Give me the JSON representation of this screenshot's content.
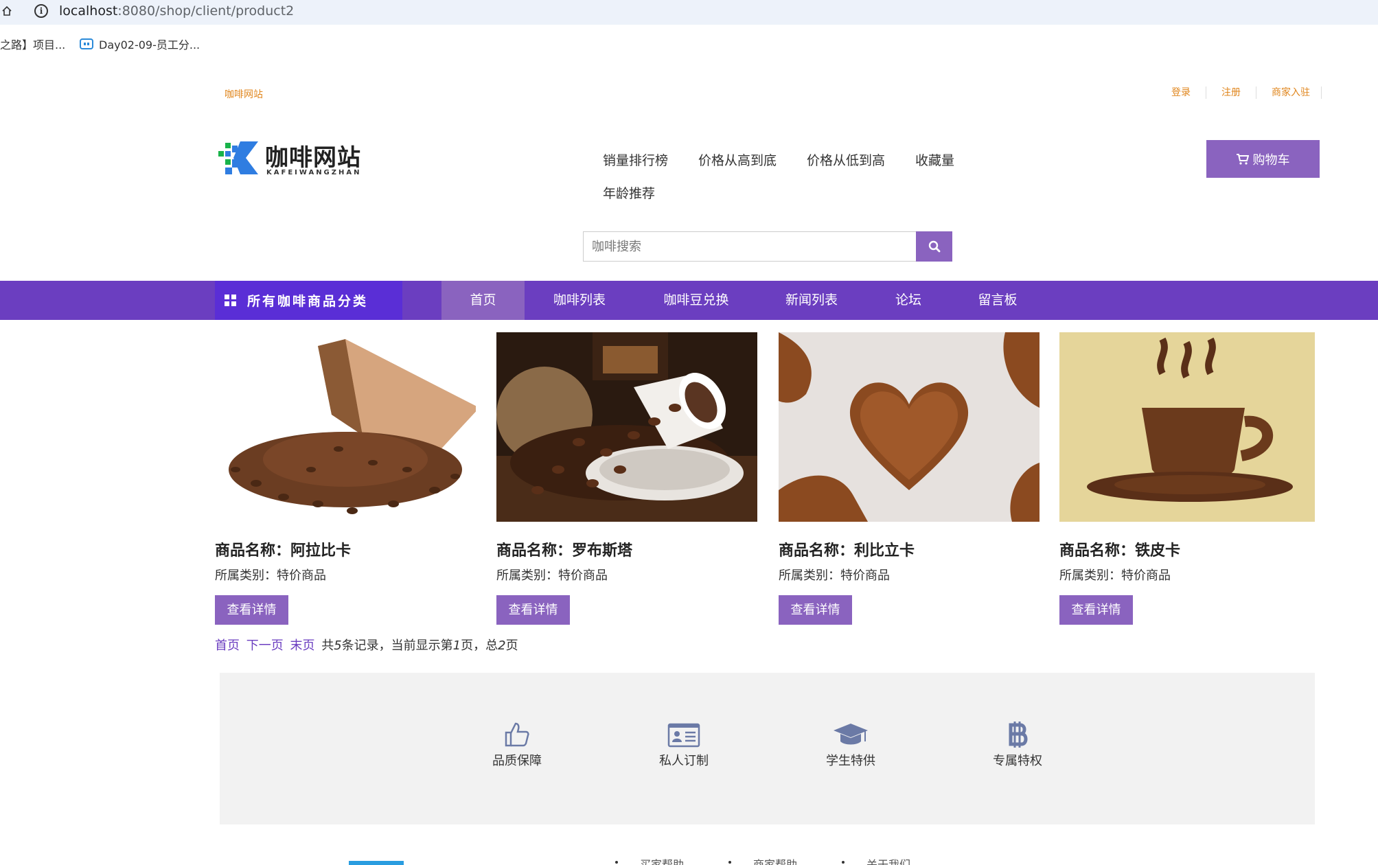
{
  "browser": {
    "url_host": "localhost",
    "url_path": ":8080/shop/client/product2",
    "bookmarks": [
      "之路】项目...",
      "Day02-09-员工分..."
    ]
  },
  "header": {
    "site_name": "咖啡网站",
    "top_links": [
      "登录",
      "注册",
      "商家入驻"
    ],
    "logo_text": "咖啡网站",
    "logo_sub": "KAFEIWANGZHAN",
    "sort_links": [
      "销量排行榜",
      "价格从高到底",
      "价格从低到高",
      "收藏量",
      "年龄推荐"
    ],
    "cart_label": "购物车",
    "search_placeholder": "咖啡搜索"
  },
  "nav": {
    "category_label": "所有咖啡商品分类",
    "items": [
      "首页",
      "咖啡列表",
      "咖啡豆兑换",
      "新闻列表",
      "论坛",
      "留言板"
    ],
    "active": "首页"
  },
  "products": [
    {
      "name": "商品名称：阿拉比卡",
      "category": "所属类别：特价商品",
      "button": "查看详情"
    },
    {
      "name": "商品名称：罗布斯塔",
      "category": "所属类别：特价商品",
      "button": "查看详情"
    },
    {
      "name": "商品名称：利比立卡",
      "category": "所属类别：特价商品",
      "button": "查看详情"
    },
    {
      "name": "商品名称：铁皮卡",
      "category": "所属类别：特价商品",
      "button": "查看详情"
    }
  ],
  "pagination": {
    "first": "首页",
    "next": "下一页",
    "last": "末页",
    "total_records_prefix": "共",
    "total_records": "5",
    "total_records_suffix": "条记录，当前显示第",
    "current_page": "1",
    "current_suffix": "页，总",
    "total_pages": "2",
    "pages_suffix": "页"
  },
  "features": [
    {
      "label": "品质保障",
      "icon": "thumbs-up-icon"
    },
    {
      "label": "私人订制",
      "icon": "id-card-icon"
    },
    {
      "label": "学生特供",
      "icon": "graduation-cap-icon"
    },
    {
      "label": "专属特权",
      "icon": "bitcoin-icon"
    }
  ],
  "footer": {
    "links": [
      "买家帮助",
      "商家帮助",
      "关于我们"
    ]
  },
  "colors": {
    "accent": "#8a63bf",
    "nav": "#6b3ec0",
    "category_box": "#5a2ed6",
    "top_link": "#e0861d"
  }
}
